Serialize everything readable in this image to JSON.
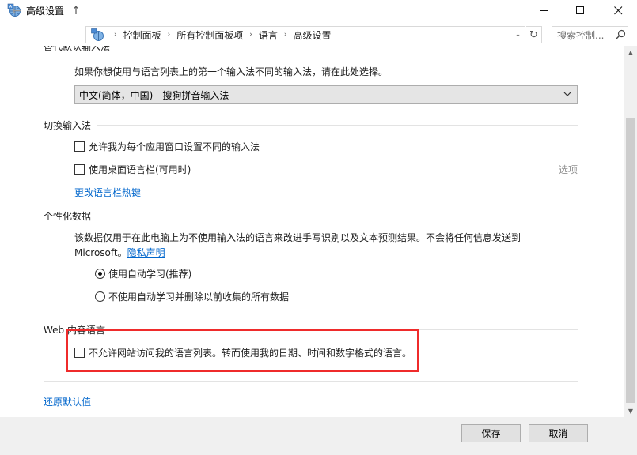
{
  "window": {
    "title": "高级设置",
    "minimize_glyph": "—",
    "maximize_glyph": "☐",
    "close_glyph": "✕"
  },
  "nav": {
    "back_glyph": "←",
    "forward_glyph": "→",
    "recent_glyph": "⌄",
    "up_glyph": "↑",
    "breadcrumbs": [
      "控制面板",
      "所有控制面板项",
      "语言",
      "高级设置"
    ],
    "breadcrumb_separator": "›",
    "dropdown_glyph": "⌄",
    "refresh_glyph": "↻",
    "search_placeholder": "搜索控制..."
  },
  "icons": {
    "app": "control-panel-language-icon",
    "search": "search-icon",
    "checkbox": "checkbox-icon",
    "radio": "radio-icon"
  },
  "content": {
    "override_input": {
      "title_partial": "替代默认输入法",
      "description": "如果你想使用与语言列表上的第一个输入法不同的输入法，请在此处选择。",
      "selected": "中文(简体，中国) - 搜狗拼音输入法"
    },
    "switch_input": {
      "title": "切换输入法",
      "option1": "允许我为每个应用窗口设置不同的输入法",
      "option1_checked": false,
      "option2": "使用桌面语言栏(可用时)",
      "option2_checked": false,
      "options_link": "选项",
      "hotkeys_link": "更改语言栏热键"
    },
    "personalization": {
      "title": "个性化数据",
      "description_line1": "该数据仅用于在此电脑上为不使用输入法的语言来改进手写识别以及文本预测结果。不会将任何信息发送到",
      "description_line2_prefix": "Microsoft。",
      "privacy_link": "隐私声明",
      "radio1": "使用自动学习(推荐)",
      "radio1_selected": true,
      "radio2": "不使用自动学习并删除以前收集的所有数据",
      "radio2_selected": false
    },
    "web_content": {
      "title": "Web 内容语言",
      "option": "不允许网站访问我的语言列表。转而使用我的日期、时间和数字格式的语言。",
      "option_checked": false
    },
    "restore_link": "还原默认值"
  },
  "footer": {
    "save_label": "保存",
    "cancel_label": "取消"
  },
  "scrollbar": {
    "up_glyph": "▲",
    "down_glyph": "▼"
  },
  "colors": {
    "link": "#0066cc",
    "highlight": "#ef2b2b",
    "footer_bg": "#f0f0f0"
  }
}
